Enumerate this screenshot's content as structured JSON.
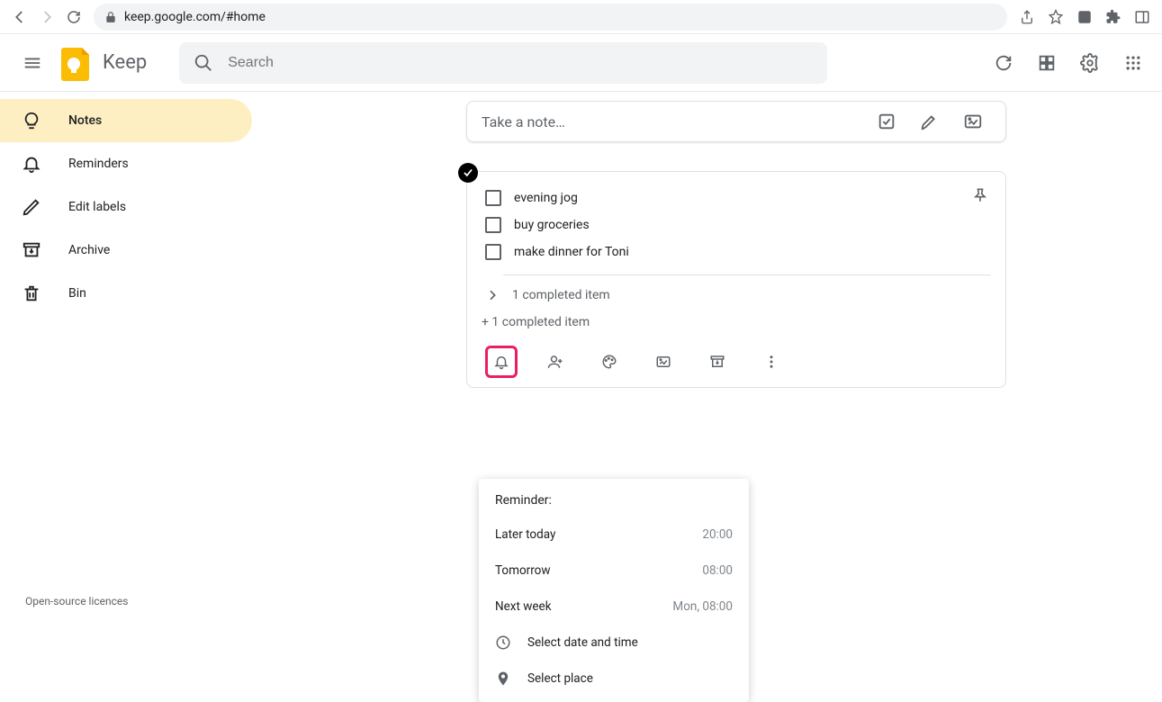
{
  "browser": {
    "url": "keep.google.com/#home"
  },
  "header": {
    "app_title": "Keep",
    "search_placeholder": "Search"
  },
  "sidebar": {
    "items": [
      {
        "label": "Notes"
      },
      {
        "label": "Reminders"
      },
      {
        "label": "Edit labels"
      },
      {
        "label": "Archive"
      },
      {
        "label": "Bin"
      }
    ],
    "licences": "Open-source licences"
  },
  "take_note": {
    "placeholder": "Take a note…"
  },
  "note": {
    "items": [
      {
        "text": "evening jog"
      },
      {
        "text": "buy groceries"
      },
      {
        "text": "make dinner for Toni"
      }
    ],
    "completed_summary": "1 completed item",
    "sub_completed": "+ 1 completed item"
  },
  "reminder_popup": {
    "title": "Reminder:",
    "options": [
      {
        "label": "Later today",
        "time": "20:00"
      },
      {
        "label": "Tomorrow",
        "time": "08:00"
      },
      {
        "label": "Next week",
        "time": "Mon, 08:00"
      }
    ],
    "select_datetime": "Select date and time",
    "select_place": "Select place"
  }
}
